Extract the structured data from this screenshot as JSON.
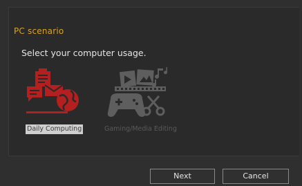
{
  "wizard": {
    "section_title": "PC scenario",
    "prompt": "Select your computer usage.",
    "options": [
      {
        "label": "Daily Computing",
        "selected": true,
        "icon": "daily-computing-icon",
        "color": "#b3201f"
      },
      {
        "label": "Gaming/Media Editing",
        "selected": false,
        "icon": "gaming-media-icon",
        "color": "#5e5e5e"
      }
    ],
    "buttons": {
      "next_label": "Next",
      "cancel_label": "Cancel"
    }
  },
  "colors": {
    "background": "#2f2f2f",
    "accent": "#d8a422",
    "selected_icon": "#b3201f",
    "unselected_icon": "#5e5e5e"
  }
}
